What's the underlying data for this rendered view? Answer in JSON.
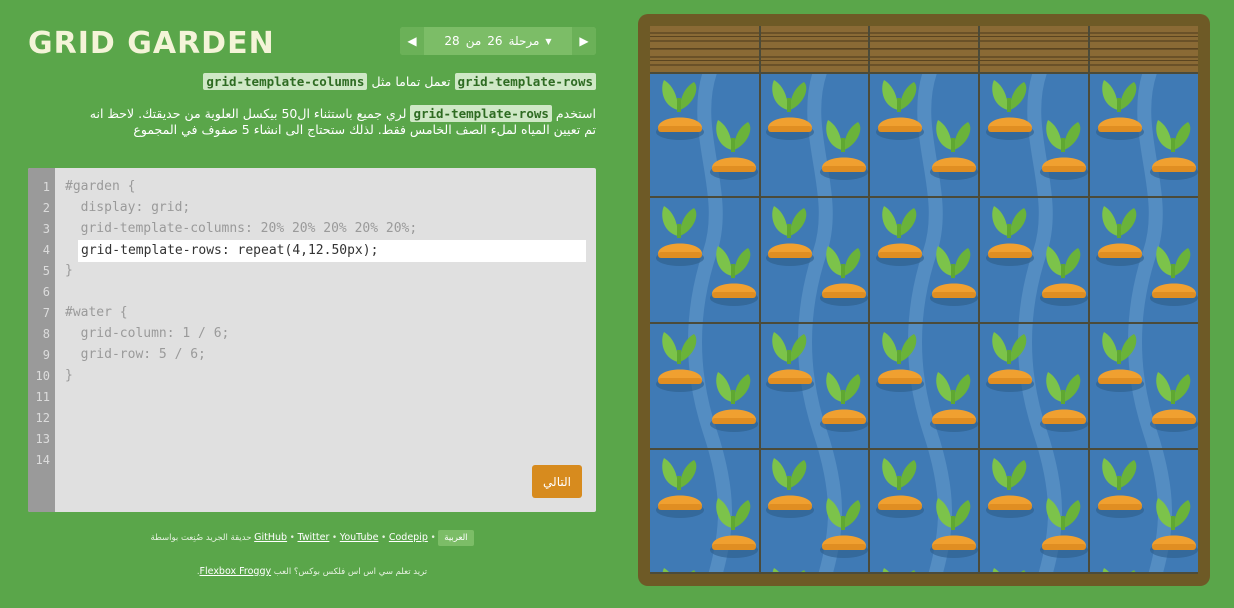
{
  "title": "GRID GARDEN",
  "level": {
    "label": "مرحلة",
    "current": "26",
    "of": "من",
    "total": "28",
    "prev_icon": "prev-arrow-icon",
    "next_icon": "next-arrow-icon"
  },
  "instructions": {
    "line1": {
      "code1": "grid-template-rows",
      "text": "تعمل تماما مثل",
      "code2": "grid-template-columns"
    },
    "line2": {
      "prefix": "استخدم",
      "code": "grid-template-rows",
      "text_a": "لري جميع باستثناء ال50 بيكسل العلوية من حديقتك. لاحظ انه",
      "text_b": "تم تعيين المياه لملء الصف الخامس فقط. لذلك ستحتاج الى انشاء 5 صفوف في المجموع"
    }
  },
  "editor": {
    "line_numbers": [
      "1",
      "2",
      "3",
      "4",
      "5",
      "6",
      "7",
      "8",
      "9",
      "10",
      "11",
      "12",
      "13",
      "14"
    ],
    "code_lines": [
      "#garden {",
      "  display: grid;",
      "  grid-template-columns: 20% 20% 20% 20% 20%;",
      "",
      "}",
      "",
      "#water {",
      "  grid-column: 1 / 6;",
      "  grid-row: 5 / 6;",
      "}"
    ],
    "input_value": "grid-template-rows: repeat(4,12.50px);",
    "next_button": "التالي"
  },
  "footer": {
    "language": "العربية",
    "links": [
      "GitHub",
      "Twitter",
      "YouTube",
      "Codepip"
    ],
    "credit": "حديقة الجريد صُنِعت بواسطة",
    "promo_text": "تريد تعلم سي اس اس فلكس بوكس؟ العب",
    "promo_link": "Flexbox Froggy",
    "promo_end": "."
  },
  "colors": {
    "background": "#5aa64a",
    "frame": "#6e5a26",
    "water": "#3f7ab5",
    "carrot": "#f0a030",
    "leaf": "#7cc34a",
    "button": "#d78b1e"
  }
}
